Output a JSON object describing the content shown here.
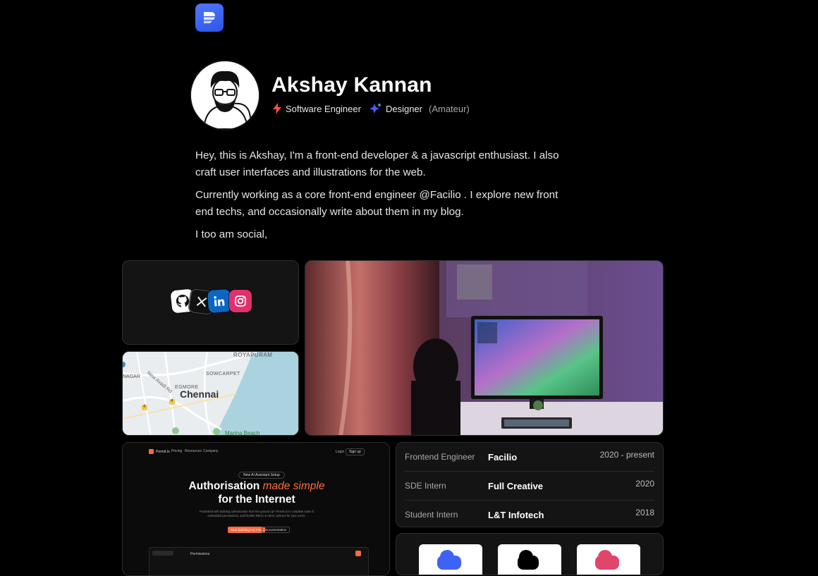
{
  "header": {
    "logo_icon": "stacked-stripes-logo-icon"
  },
  "profile": {
    "name": "Akshay Kannan",
    "roles": [
      {
        "icon": "lightning-icon",
        "label": "Software Engineer"
      },
      {
        "icon": "sparkle-icon",
        "label": "Designer",
        "note": "(Amateur)"
      }
    ]
  },
  "bio": {
    "p1": "Hey, this is Akshay, I'm a front-end developer & a javascript enthusiast. I also craft user interfaces and illustrations for the web.",
    "p2": "Currently working as a core front-end engineer @Facilio . I explore new front end techs, and occasionally write about them in my blog.",
    "p3": "I too am social,"
  },
  "social": [
    "github-icon",
    "x-icon",
    "linkedin-icon",
    "instagram-icon"
  ],
  "map": {
    "city": "Chennai",
    "labels": [
      "ROYAPURAM",
      "SOWCARPET",
      "EGMORE",
      "New Avadi Rd",
      "NAGAR",
      "Marina Beach"
    ],
    "markers": [
      "4",
      "4"
    ]
  },
  "site_preview": {
    "brand": "Permit.io",
    "nav": [
      "Pricing",
      "Resources",
      "Company"
    ],
    "login": "Login",
    "cta_top": "Sign up",
    "pill": "New AI Assistant Setup",
    "headline_plain": "Authorisation",
    "headline_accent": "made simple",
    "headline_line2": "for the Internet",
    "sub": "Frustrated with building authorization from the ground up? Permit.io is complete suite of embedded permissions, and flexible RBAC & ABAC policies for your users.",
    "button_primary": "Start Building For Free",
    "button_secondary": "Documentation",
    "footer_label": "Permissions"
  },
  "experience": [
    {
      "role": "Frontend Engineer",
      "company": "Facilio",
      "years": "2020 - present"
    },
    {
      "role": "SDE Intern",
      "company": "Full Creative",
      "years": "2020"
    },
    {
      "role": "Student Intern",
      "company": "L&T Infotech",
      "years": "2018"
    }
  ],
  "colors": {
    "accent_blue": "#3d63f5",
    "lightning_red": "#ff4d3d",
    "accent_orange": "#ff6a3d",
    "linkedin": "#0a66c2",
    "instagram": "#e1306c"
  }
}
